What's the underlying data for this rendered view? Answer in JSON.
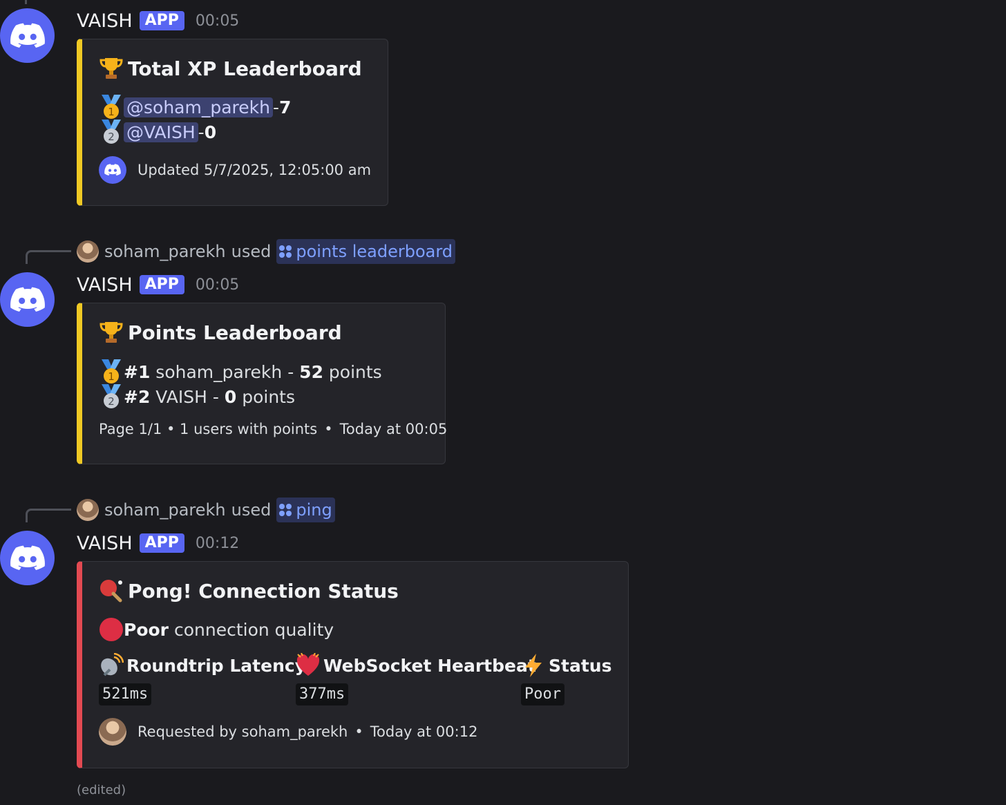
{
  "messages": [
    {
      "username": "VAISH",
      "app_tag": "APP",
      "time": "00:05",
      "embed": {
        "title": "Total XP Leaderboard",
        "entries": [
          {
            "mention": "@soham_parekh",
            "separator": " - ",
            "value": "7"
          },
          {
            "mention": "@VAISH",
            "separator": " - ",
            "value": "0"
          }
        ],
        "footer": "Updated 5/7/2025, 12:05:00 am"
      }
    },
    {
      "reply": {
        "user": "soham_parekh",
        "verb": "used",
        "command": "points leaderboard"
      },
      "username": "VAISH",
      "app_tag": "APP",
      "time": "00:05",
      "embed": {
        "title": "Points Leaderboard",
        "entries": [
          {
            "rank": "#1",
            "name": " soham_parekh - ",
            "value": "52",
            "unit": " points"
          },
          {
            "rank": "#2",
            "name": " VAISH - ",
            "value": "0",
            "unit": " points"
          }
        ],
        "footer_left": "Page 1/1 • 1 users with points",
        "footer_right": "Today at 00:05"
      }
    },
    {
      "reply": {
        "user": "soham_parekh",
        "verb": "used",
        "command": "ping"
      },
      "username": "VAISH",
      "app_tag": "APP",
      "time": "00:12",
      "embed": {
        "title": "Pong! Connection Status",
        "quality_bold": "Poor",
        "quality_rest": " connection quality",
        "fields": [
          {
            "name": "Roundtrip Latency",
            "value": "521ms",
            "icon": "satellite-dish-icon"
          },
          {
            "name": "WebSocket Heartbeat",
            "value": "377ms",
            "icon": "heart-icon"
          },
          {
            "name": "Status",
            "value": "Poor",
            "icon": "lightning-icon"
          }
        ],
        "footer_left": "Requested by soham_parekh",
        "footer_right": "Today at 00:12"
      },
      "edited": "(edited)"
    }
  ],
  "colors": {
    "accent": "#5865f2",
    "embed_yellow": "#f0c924",
    "embed_red": "#e34a52",
    "mention_bg": "#3c4270",
    "command_text": "#7ea0ff"
  }
}
